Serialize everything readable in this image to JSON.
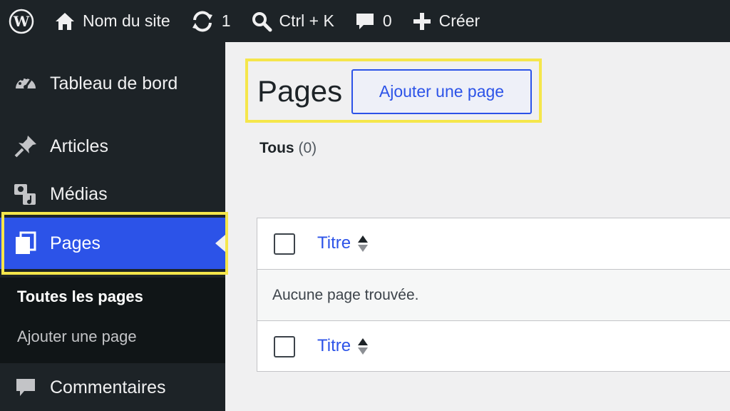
{
  "adminbar": {
    "site_name": "Nom du site",
    "updates_count": "1",
    "search_shortcut": "Ctrl + K",
    "comments_count": "0",
    "create_label": "Créer"
  },
  "sidebar": {
    "items": [
      {
        "label": "Tableau de bord",
        "icon": "dashboard-icon"
      },
      {
        "label": "Articles",
        "icon": "pushpin-icon"
      },
      {
        "label": "Médias",
        "icon": "media-icon"
      },
      {
        "label": "Pages",
        "icon": "pages-icon",
        "current": true
      },
      {
        "label": "Commentaires",
        "icon": "comment-icon"
      }
    ],
    "submenu": [
      {
        "label": "Toutes les pages",
        "active": true
      },
      {
        "label": "Ajouter une page",
        "active": false
      }
    ]
  },
  "main": {
    "title": "Pages",
    "add_button": "Ajouter une page",
    "filter": {
      "label": "Tous",
      "count": "(0)"
    },
    "table": {
      "column_title": "Titre",
      "empty_message": "Aucune page trouvée."
    }
  },
  "colors": {
    "adminbar_bg": "#1d2327",
    "accent": "#2c53e8",
    "highlight": "#f5e64b"
  }
}
